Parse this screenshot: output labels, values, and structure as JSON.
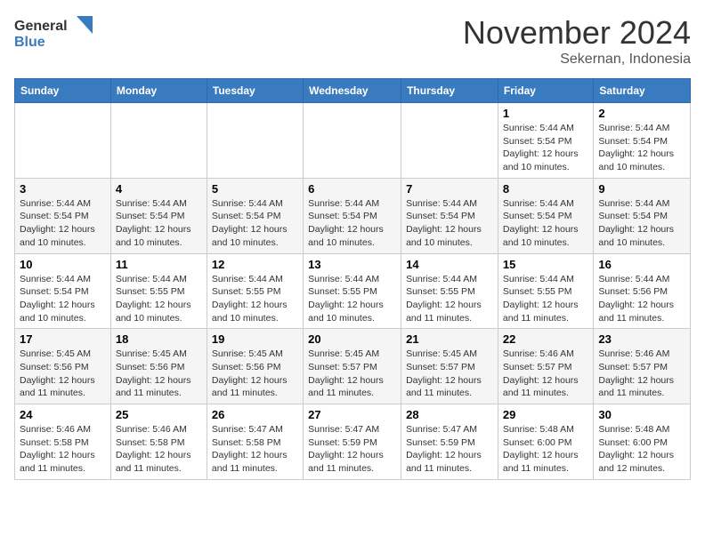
{
  "header": {
    "logo_general": "General",
    "logo_blue": "Blue",
    "month": "November 2024",
    "location": "Sekernan, Indonesia"
  },
  "days_of_week": [
    "Sunday",
    "Monday",
    "Tuesday",
    "Wednesday",
    "Thursday",
    "Friday",
    "Saturday"
  ],
  "weeks": [
    [
      {
        "day": "",
        "info": ""
      },
      {
        "day": "",
        "info": ""
      },
      {
        "day": "",
        "info": ""
      },
      {
        "day": "",
        "info": ""
      },
      {
        "day": "",
        "info": ""
      },
      {
        "day": "1",
        "info": "Sunrise: 5:44 AM\nSunset: 5:54 PM\nDaylight: 12 hours and 10 minutes."
      },
      {
        "day": "2",
        "info": "Sunrise: 5:44 AM\nSunset: 5:54 PM\nDaylight: 12 hours and 10 minutes."
      }
    ],
    [
      {
        "day": "3",
        "info": "Sunrise: 5:44 AM\nSunset: 5:54 PM\nDaylight: 12 hours and 10 minutes."
      },
      {
        "day": "4",
        "info": "Sunrise: 5:44 AM\nSunset: 5:54 PM\nDaylight: 12 hours and 10 minutes."
      },
      {
        "day": "5",
        "info": "Sunrise: 5:44 AM\nSunset: 5:54 PM\nDaylight: 12 hours and 10 minutes."
      },
      {
        "day": "6",
        "info": "Sunrise: 5:44 AM\nSunset: 5:54 PM\nDaylight: 12 hours and 10 minutes."
      },
      {
        "day": "7",
        "info": "Sunrise: 5:44 AM\nSunset: 5:54 PM\nDaylight: 12 hours and 10 minutes."
      },
      {
        "day": "8",
        "info": "Sunrise: 5:44 AM\nSunset: 5:54 PM\nDaylight: 12 hours and 10 minutes."
      },
      {
        "day": "9",
        "info": "Sunrise: 5:44 AM\nSunset: 5:54 PM\nDaylight: 12 hours and 10 minutes."
      }
    ],
    [
      {
        "day": "10",
        "info": "Sunrise: 5:44 AM\nSunset: 5:54 PM\nDaylight: 12 hours and 10 minutes."
      },
      {
        "day": "11",
        "info": "Sunrise: 5:44 AM\nSunset: 5:55 PM\nDaylight: 12 hours and 10 minutes."
      },
      {
        "day": "12",
        "info": "Sunrise: 5:44 AM\nSunset: 5:55 PM\nDaylight: 12 hours and 10 minutes."
      },
      {
        "day": "13",
        "info": "Sunrise: 5:44 AM\nSunset: 5:55 PM\nDaylight: 12 hours and 10 minutes."
      },
      {
        "day": "14",
        "info": "Sunrise: 5:44 AM\nSunset: 5:55 PM\nDaylight: 12 hours and 11 minutes."
      },
      {
        "day": "15",
        "info": "Sunrise: 5:44 AM\nSunset: 5:55 PM\nDaylight: 12 hours and 11 minutes."
      },
      {
        "day": "16",
        "info": "Sunrise: 5:44 AM\nSunset: 5:56 PM\nDaylight: 12 hours and 11 minutes."
      }
    ],
    [
      {
        "day": "17",
        "info": "Sunrise: 5:45 AM\nSunset: 5:56 PM\nDaylight: 12 hours and 11 minutes."
      },
      {
        "day": "18",
        "info": "Sunrise: 5:45 AM\nSunset: 5:56 PM\nDaylight: 12 hours and 11 minutes."
      },
      {
        "day": "19",
        "info": "Sunrise: 5:45 AM\nSunset: 5:56 PM\nDaylight: 12 hours and 11 minutes."
      },
      {
        "day": "20",
        "info": "Sunrise: 5:45 AM\nSunset: 5:57 PM\nDaylight: 12 hours and 11 minutes."
      },
      {
        "day": "21",
        "info": "Sunrise: 5:45 AM\nSunset: 5:57 PM\nDaylight: 12 hours and 11 minutes."
      },
      {
        "day": "22",
        "info": "Sunrise: 5:46 AM\nSunset: 5:57 PM\nDaylight: 12 hours and 11 minutes."
      },
      {
        "day": "23",
        "info": "Sunrise: 5:46 AM\nSunset: 5:57 PM\nDaylight: 12 hours and 11 minutes."
      }
    ],
    [
      {
        "day": "24",
        "info": "Sunrise: 5:46 AM\nSunset: 5:58 PM\nDaylight: 12 hours and 11 minutes."
      },
      {
        "day": "25",
        "info": "Sunrise: 5:46 AM\nSunset: 5:58 PM\nDaylight: 12 hours and 11 minutes."
      },
      {
        "day": "26",
        "info": "Sunrise: 5:47 AM\nSunset: 5:58 PM\nDaylight: 12 hours and 11 minutes."
      },
      {
        "day": "27",
        "info": "Sunrise: 5:47 AM\nSunset: 5:59 PM\nDaylight: 12 hours and 11 minutes."
      },
      {
        "day": "28",
        "info": "Sunrise: 5:47 AM\nSunset: 5:59 PM\nDaylight: 12 hours and 11 minutes."
      },
      {
        "day": "29",
        "info": "Sunrise: 5:48 AM\nSunset: 6:00 PM\nDaylight: 12 hours and 11 minutes."
      },
      {
        "day": "30",
        "info": "Sunrise: 5:48 AM\nSunset: 6:00 PM\nDaylight: 12 hours and 12 minutes."
      }
    ]
  ]
}
